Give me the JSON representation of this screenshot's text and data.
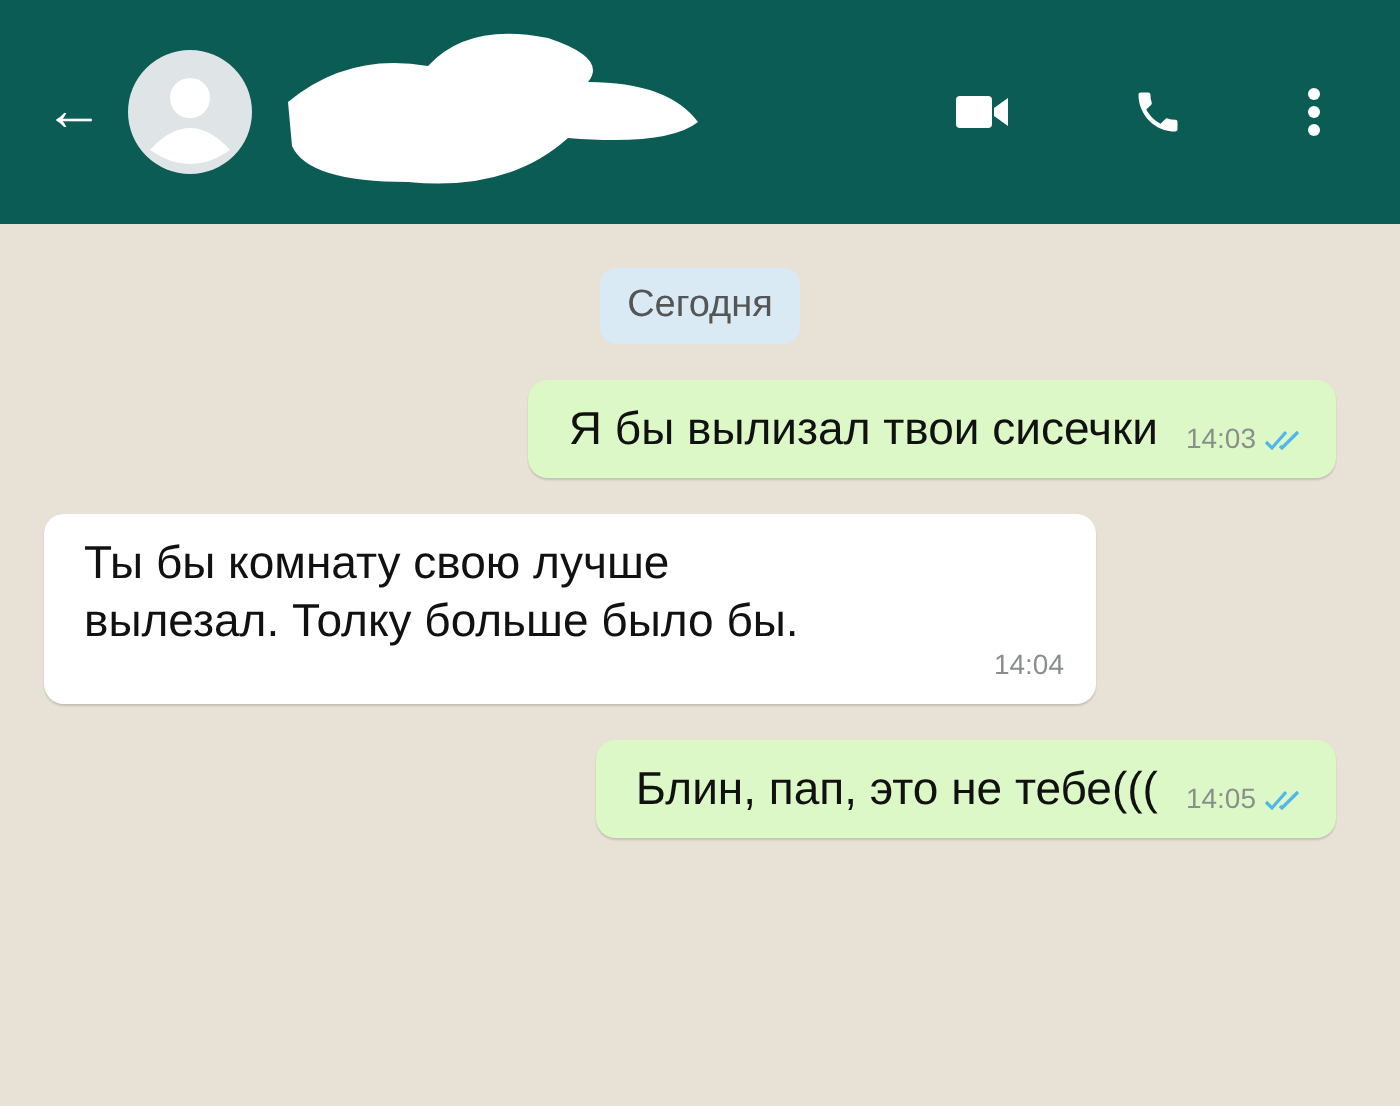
{
  "header": {
    "back": "←"
  },
  "date_chip": "Сегодня",
  "messages": [
    {
      "kind": "outgoing",
      "text": "Я бы вылизал твои сисечки",
      "time": "14:03",
      "read": true
    },
    {
      "kind": "incoming",
      "text": "Ты бы комнату свою лучше вылезал. Толку больше было бы.",
      "time": "14:04"
    },
    {
      "kind": "outgoing",
      "text": "Блин, пап, это не тебе(((",
      "time": "14:05",
      "read": true
    }
  ]
}
